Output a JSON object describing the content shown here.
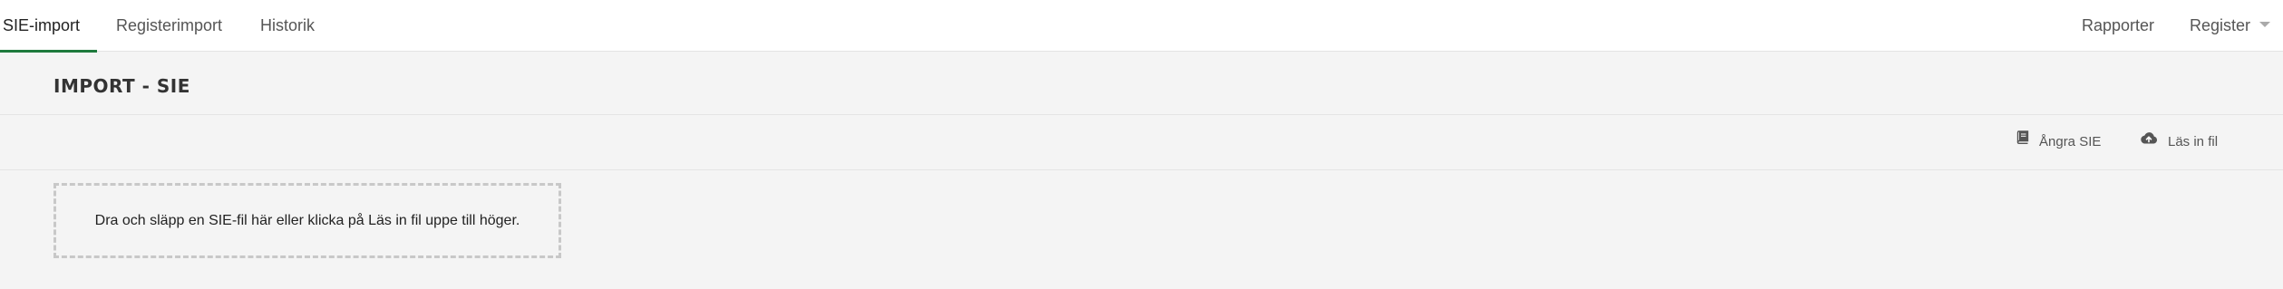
{
  "nav": {
    "tabs": [
      {
        "label": "SIE-import",
        "active": true
      },
      {
        "label": "Registerimport",
        "active": false
      },
      {
        "label": "Historik",
        "active": false
      }
    ],
    "right_menu": {
      "rapporter": "Rapporter",
      "register": "Register"
    }
  },
  "page": {
    "title": "IMPORT - SIE"
  },
  "toolbar": {
    "undo_label": "Ångra SIE",
    "undo_icon": "book-icon",
    "load_label": "Läs in fil",
    "load_icon": "cloud-upload-icon"
  },
  "dropzone": {
    "text": "Dra och släpp en SIE-fil här eller klicka på Läs in fil uppe till höger."
  },
  "colors": {
    "accent": "#1e7a3c",
    "background": "#f4f4f4",
    "nav_background": "#ffffff"
  }
}
